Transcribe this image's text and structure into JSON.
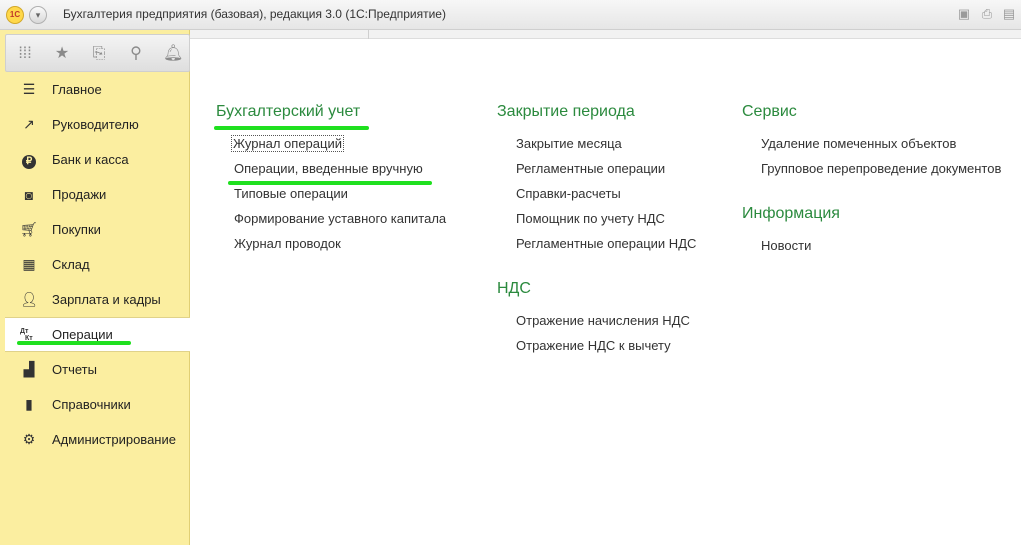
{
  "titlebar": {
    "logo": "1С",
    "title": "Бухгалтерия предприятия (базовая), редакция 3.0  (1С:Предприятие)",
    "icons": [
      "save-icon",
      "print-icon",
      "preview-icon"
    ]
  },
  "quick_toolbar": {
    "icons": [
      "apps-grid-icon",
      "star-icon",
      "history-icon",
      "search-icon",
      "bell-icon"
    ]
  },
  "sidebar": {
    "items": [
      {
        "label": "Главное",
        "icon": "menu-lines-icon"
      },
      {
        "label": "Руководителю",
        "icon": "trend-icon"
      },
      {
        "label": "Банк и касса",
        "icon": "ruble-coin-icon"
      },
      {
        "label": "Продажи",
        "icon": "shopping-bag-icon"
      },
      {
        "label": "Покупки",
        "icon": "cart-icon"
      },
      {
        "label": "Склад",
        "icon": "warehouse-icon"
      },
      {
        "label": "Зарплата и кадры",
        "icon": "person-icon"
      },
      {
        "label": "Операции",
        "icon": "dt-kt-icon",
        "active": true,
        "icon_text_top": "Дт",
        "icon_text_bottom": "Кт"
      },
      {
        "label": "Отчеты",
        "icon": "bar-chart-icon"
      },
      {
        "label": "Справочники",
        "icon": "books-icon"
      },
      {
        "label": "Администрирование",
        "icon": "gear-icon"
      }
    ]
  },
  "main": {
    "columns": [
      {
        "sections": [
          {
            "title": "Бухгалтерский учет",
            "links": [
              "Журнал операций",
              "Операции, введенные вручную",
              "Типовые операции",
              "Формирование уставного капитала",
              "Журнал проводок"
            ]
          }
        ]
      },
      {
        "sections": [
          {
            "title": "Закрытие периода",
            "links": [
              "Закрытие месяца",
              "Регламентные операции",
              "Справки-расчеты",
              "Помощник по учету НДС",
              "Регламентные операции НДС"
            ]
          },
          {
            "title": "НДС",
            "links": [
              "Отражение начисления НДС",
              "Отражение НДС к вычету"
            ]
          }
        ]
      },
      {
        "sections": [
          {
            "title": "Сервис",
            "links": [
              "Удаление помеченных объектов",
              "Групповое перепроведение документов"
            ]
          },
          {
            "title": "Информация",
            "links": [
              "Новости"
            ]
          }
        ]
      }
    ]
  },
  "colors": {
    "sidebar_bg": "#fbeea0",
    "section_title": "#2b8a3e",
    "highlight": "#1fe01f"
  }
}
